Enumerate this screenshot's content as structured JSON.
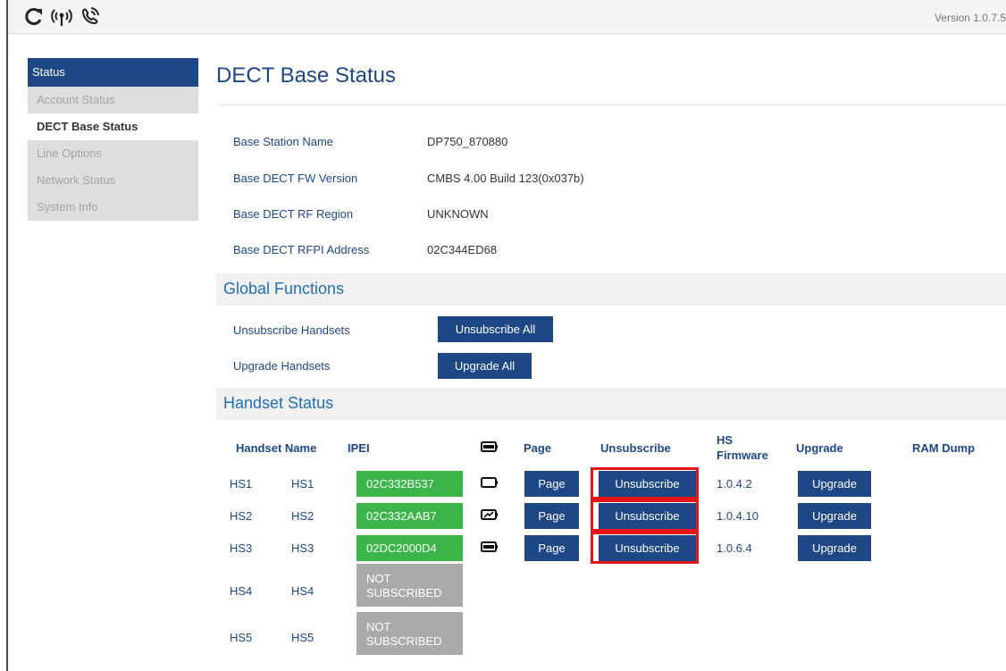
{
  "header": {
    "version": "Version 1.0.7.5",
    "icons": [
      "refresh-icon",
      "base-signal-icon",
      "handset-signal-icon"
    ]
  },
  "sidebar": {
    "header": "Status",
    "items": [
      {
        "label": "Account Status",
        "active": false
      },
      {
        "label": "DECT Base Status",
        "active": true
      },
      {
        "label": "Line Options",
        "active": false
      },
      {
        "label": "Network Status",
        "active": false
      },
      {
        "label": "System Info",
        "active": false
      }
    ]
  },
  "main": {
    "title": "DECT Base Status",
    "info": [
      {
        "label": "Base Station Name",
        "value": "DP750_870880"
      },
      {
        "label": "Base DECT FW Version",
        "value": "CMBS 4.00 Build 123(0x037b)"
      },
      {
        "label": "Base DECT RF Region",
        "value": "UNKNOWN"
      },
      {
        "label": "Base DECT RFPI Address",
        "value": "02C344ED68"
      }
    ],
    "global_functions": {
      "title": "Global Functions",
      "rows": [
        {
          "label": "Unsubscribe Handsets",
          "button": "Unsubscribe All"
        },
        {
          "label": "Upgrade Handsets",
          "button": "Upgrade All"
        }
      ]
    },
    "handset_status": {
      "title": "Handset Status",
      "columns": {
        "handset_name": "Handset Name",
        "ipei": "IPEI",
        "battery": "battery-icon",
        "page": "Page",
        "unsubscribe": "Unsubscribe",
        "hs_firmware_line1": "HS",
        "hs_firmware_line2": "Firmware",
        "upgrade": "Upgrade",
        "ram_dump": "RAM Dump"
      },
      "rows": [
        {
          "id": "HS1",
          "name": "HS1",
          "ipei": "02C332B537",
          "battery": "battery-empty-icon",
          "page": "Page",
          "unsubscribe": "Unsubscribe",
          "firmware": "1.0.4.2",
          "upgrade": "Upgrade"
        },
        {
          "id": "HS2",
          "name": "HS2",
          "ipei": "02C332AAB7",
          "battery": "battery-charging-icon",
          "page": "Page",
          "unsubscribe": "Unsubscribe",
          "firmware": "1.0.4.10",
          "upgrade": "Upgrade"
        },
        {
          "id": "HS3",
          "name": "HS3",
          "ipei": "02DC2000D4",
          "battery": "battery-full-icon",
          "page": "Page",
          "unsubscribe": "Unsubscribe",
          "firmware": "1.0.6.4",
          "upgrade": "Upgrade"
        },
        {
          "id": "HS4",
          "name": "HS4",
          "ipei_line1": "NOT",
          "ipei_line2": "SUBSCRIBED"
        },
        {
          "id": "HS5",
          "name": "HS5",
          "ipei_line1": "NOT",
          "ipei_line2": "SUBSCRIBED"
        }
      ]
    }
  },
  "colors": {
    "brand": "#1e4785",
    "section_title": "#1e6fb5",
    "subscribed": "#3bb54a",
    "not_subscribed": "#aaaaaa",
    "highlight": "#e8141c"
  }
}
